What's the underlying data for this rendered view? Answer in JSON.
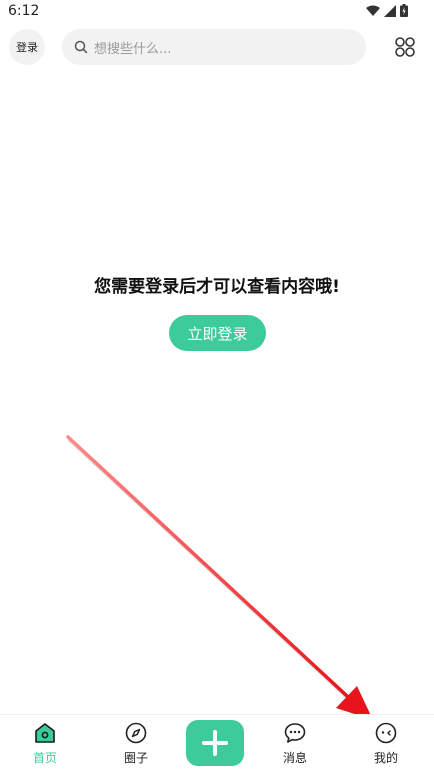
{
  "status_bar": {
    "time": "6:12",
    "icons": [
      "wifi-icon",
      "signal-icon",
      "battery-icon"
    ]
  },
  "header": {
    "login_label": "登录",
    "search_placeholder": "想搜些什么...",
    "menu_icon": "grid-icon"
  },
  "main": {
    "message": "您需要登录后才可以查看内容哦!",
    "login_button": "立即登录"
  },
  "bottom_nav": {
    "items": [
      {
        "label": "首页",
        "icon": "home-icon",
        "active": true
      },
      {
        "label": "圈子",
        "icon": "compass-icon",
        "active": false
      },
      {
        "label": "",
        "icon": "plus-icon",
        "active": false
      },
      {
        "label": "消息",
        "icon": "chat-icon",
        "active": false
      },
      {
        "label": "我的",
        "icon": "face-icon",
        "active": false
      }
    ]
  },
  "colors": {
    "accent": "#3ecb9b",
    "arrow": "#e8141b",
    "search_bg": "#f2f2f2"
  }
}
